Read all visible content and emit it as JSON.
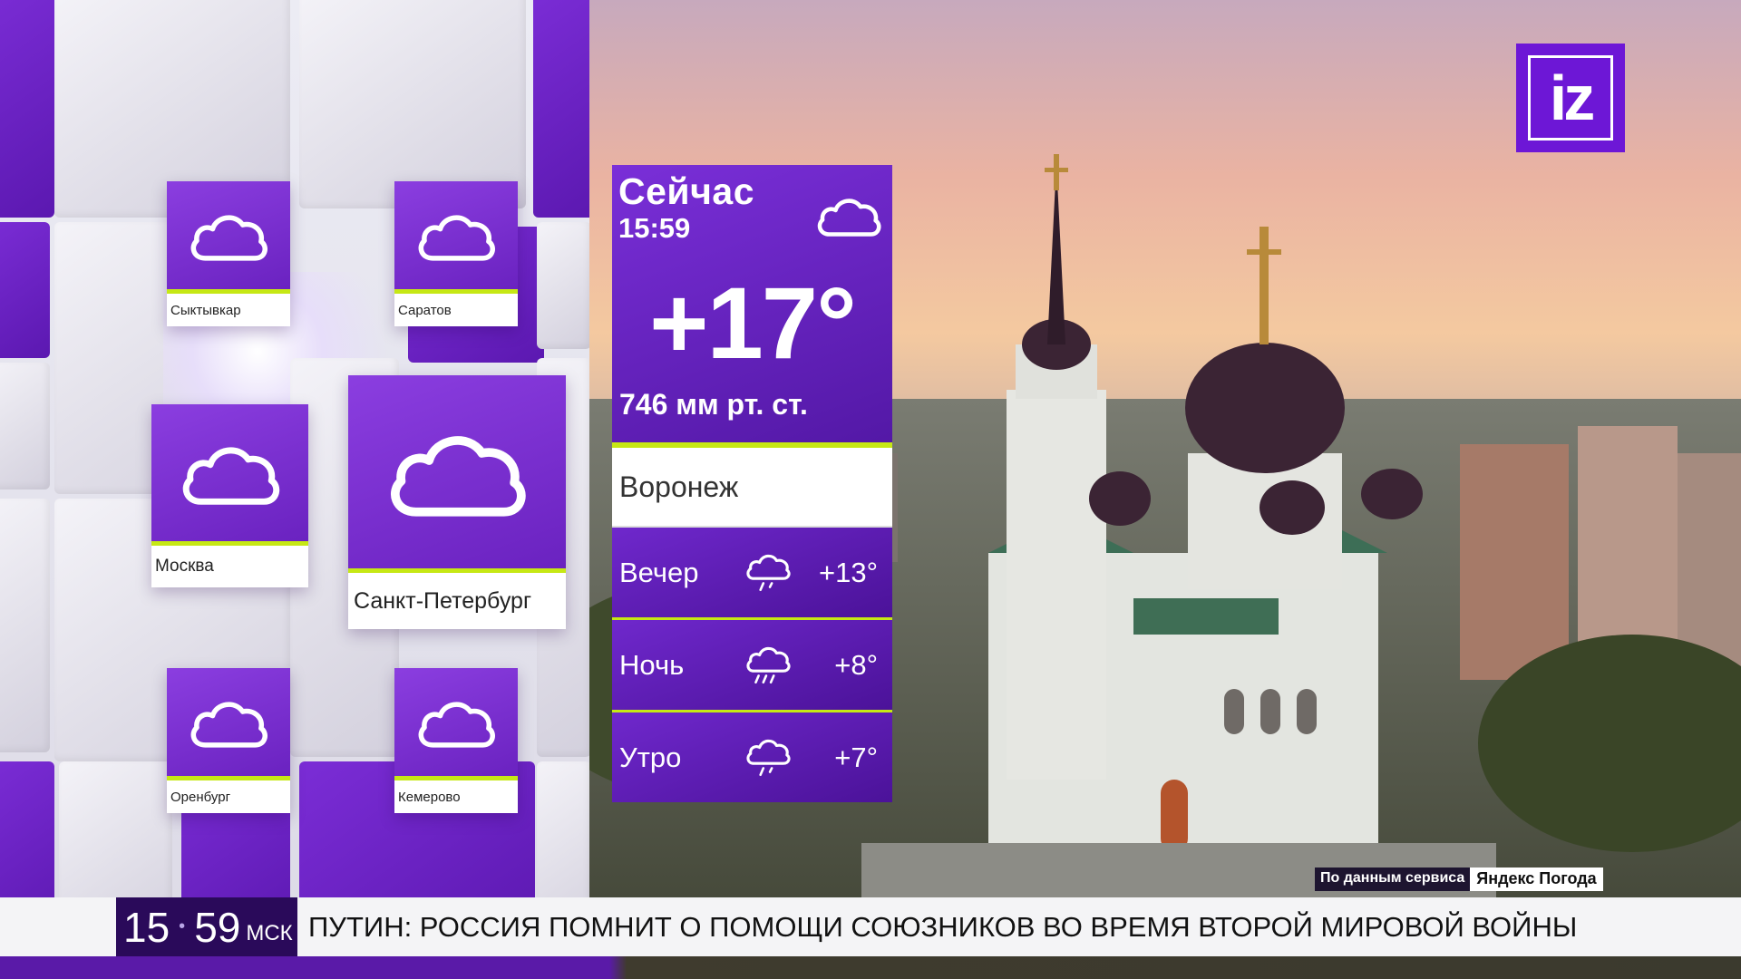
{
  "logo": {
    "text": "iz"
  },
  "now": {
    "title": "Сейчас",
    "time": "15:59",
    "temperature": "+17°",
    "pressure": "746 мм рт. ст.",
    "icon": "cloud-icon"
  },
  "city": "Воронеж",
  "forecast": [
    {
      "name": "Вечер",
      "temp": "+13°",
      "icon": "light-rain-icon"
    },
    {
      "name": "Ночь",
      "temp": "+8°",
      "icon": "rain-icon"
    },
    {
      "name": "Утро",
      "temp": "+7°",
      "icon": "light-rain-icon"
    }
  ],
  "cities": [
    {
      "name": "Сыктывкар",
      "icon": "cloud-icon"
    },
    {
      "name": "Саратов",
      "icon": "cloud-icon"
    },
    {
      "name": "Москва",
      "icon": "cloud-icon"
    },
    {
      "name": "Санкт-Петербург",
      "icon": "cloud-icon"
    },
    {
      "name": "Оренбург",
      "icon": "cloud-icon"
    },
    {
      "name": "Кемерово",
      "icon": "cloud-icon"
    }
  ],
  "source": {
    "prefix": "По данным сервиса",
    "service": "Яндекс Погода"
  },
  "ticker": {
    "clock_hours": "15",
    "clock_minutes": "59",
    "clock_zone": "МСК",
    "headline": "ПУТИН: РОССИЯ ПОМНИТ О ПОМОЩИ СОЮЗНИКОВ ВО ВРЕМЯ ВТОРОЙ МИРОВОЙ ВОЙНЫ"
  },
  "colors": {
    "accent_purple": "#6d17d6",
    "accent_lime": "#c6e814",
    "ticker_dark": "#2a0a5a"
  }
}
